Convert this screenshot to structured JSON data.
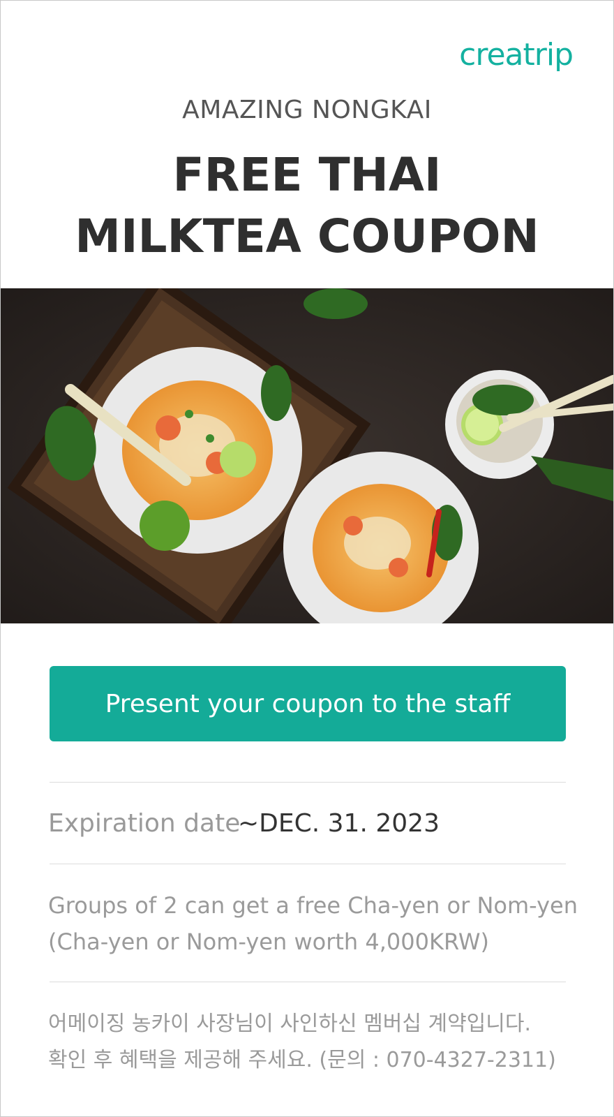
{
  "brand": {
    "logo_text": "creatrip",
    "accent_color": "#14ab98"
  },
  "header": {
    "subtitle": "AMAZING NONGKAI",
    "title_line1": "FREE THAI",
    "title_line2": "MILKTEA COUPON"
  },
  "hero_image": {
    "subject": "thai-noodle-dishes-photo"
  },
  "cta": {
    "label": "Present your coupon to the staff"
  },
  "expiration": {
    "label": "Expiration date",
    "value": "~DEC. 31. 2023"
  },
  "description": {
    "line1": "Groups of 2 can get a free Cha-yen or Nom-yen",
    "line2": "(Cha-yen or Nom-yen worth 4,000KRW)"
  },
  "note": {
    "line1": "어메이징 농카이 사장님이 사인하신 멤버십 계약입니다.",
    "line2": "확인 후 혜택을 제공해 주세요. (문의 : 070-4327-2311)"
  }
}
